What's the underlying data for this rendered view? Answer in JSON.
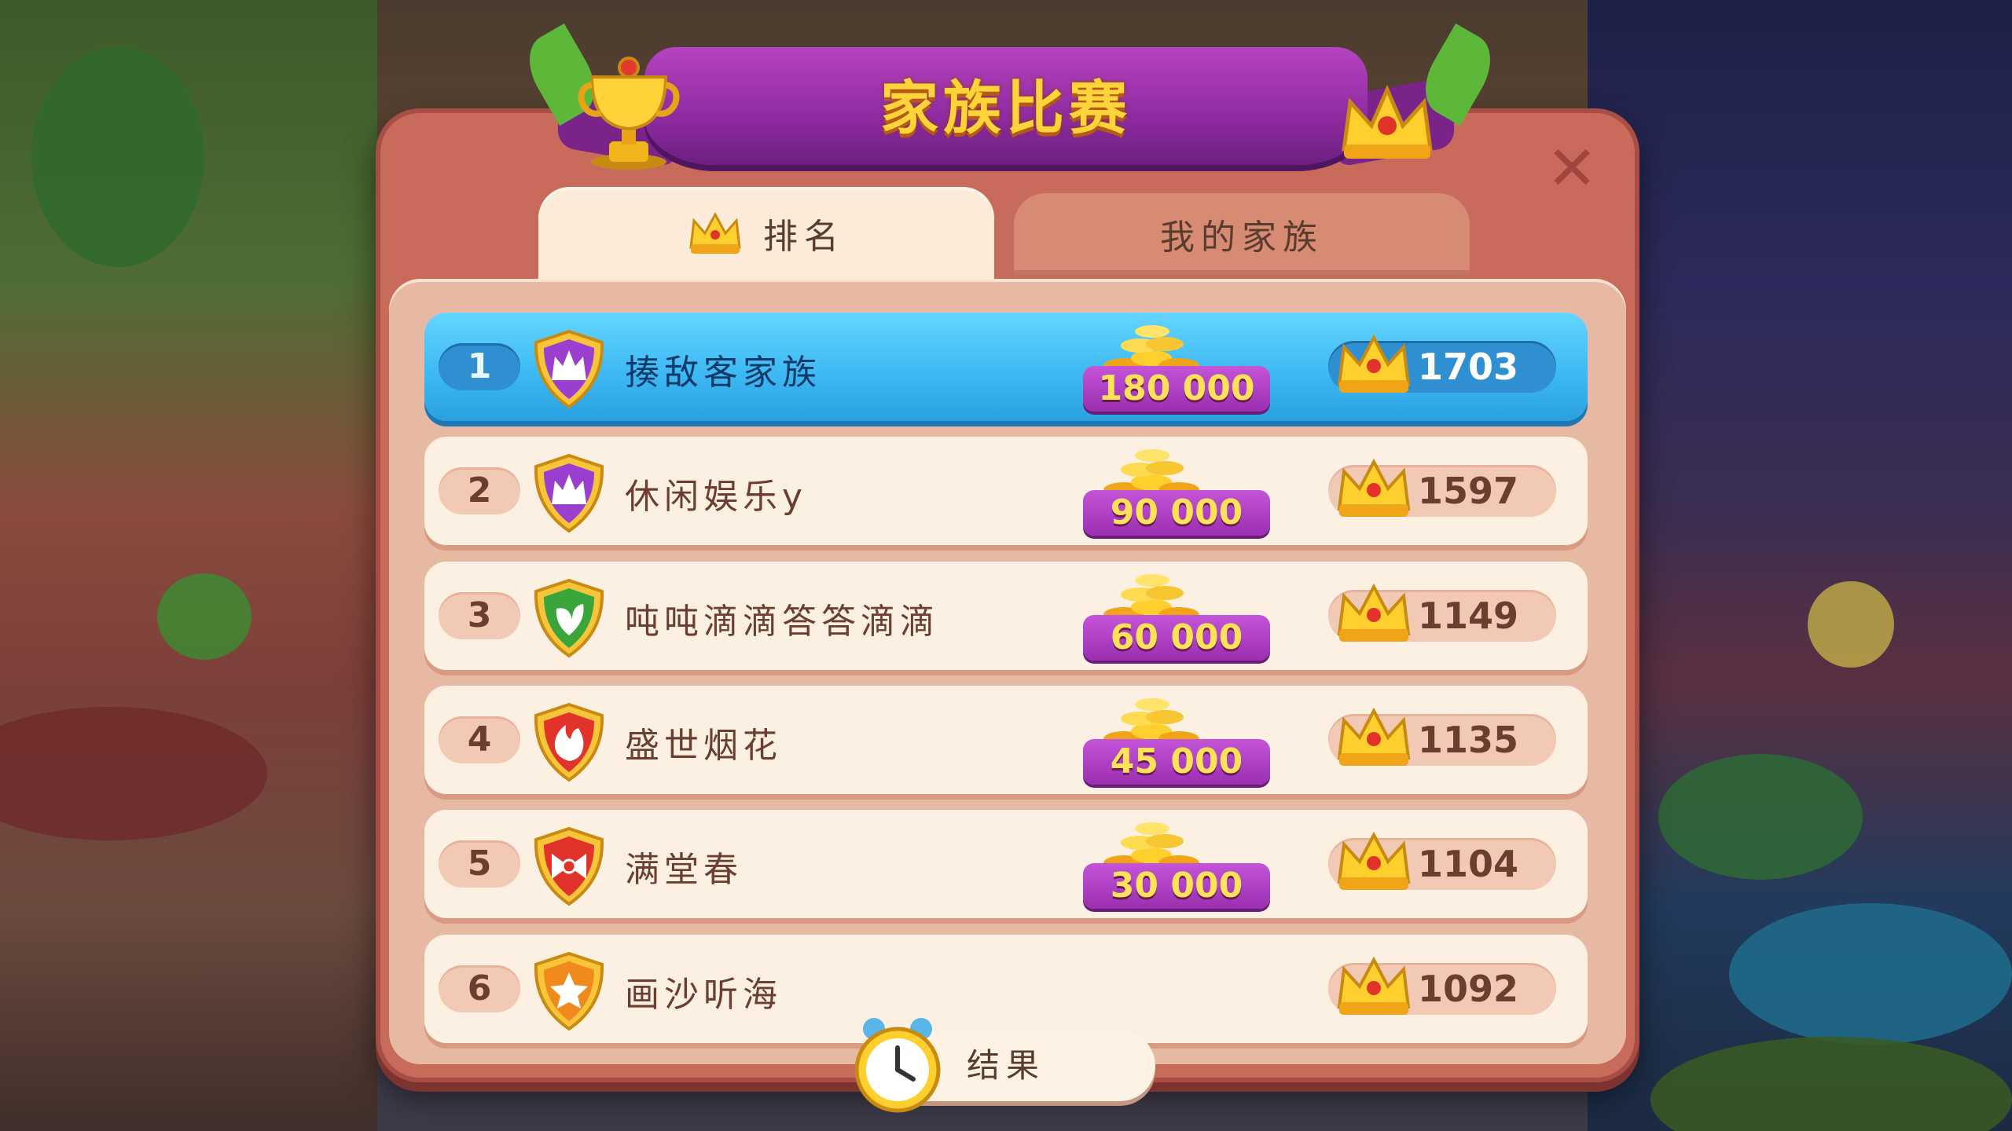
{
  "title": "家族比赛",
  "tabs": [
    {
      "label": "排名",
      "active": true
    },
    {
      "label": "我的家族",
      "active": false
    }
  ],
  "rows": [
    {
      "rank": "1",
      "name": "揍敌客家族",
      "prize": "180 000",
      "score": "1703",
      "badge": "crown-badge-icon",
      "badge_color": "#9b3fd0"
    },
    {
      "rank": "2",
      "name": "休闲娱乐y",
      "prize": "90 000",
      "score": "1597",
      "badge": "crown-badge-icon",
      "badge_color": "#9b3fd0"
    },
    {
      "rank": "3",
      "name": "吨吨滴滴答答滴滴",
      "prize": "60 000",
      "score": "1149",
      "badge": "leaf-badge-icon",
      "badge_color": "#3aa53a"
    },
    {
      "rank": "4",
      "name": "盛世烟花",
      "prize": "45 000",
      "score": "1135",
      "badge": "flame-badge-icon",
      "badge_color": "#e2332b"
    },
    {
      "rank": "5",
      "name": "满堂春",
      "prize": "30 000",
      "score": "1104",
      "badge": "bow-badge-icon",
      "badge_color": "#e2332b"
    },
    {
      "rank": "6",
      "name": "画沙听海",
      "prize": "",
      "score": "1092",
      "badge": "star-badge-icon",
      "badge_color": "#f08a1c"
    }
  ],
  "result_label": "结果",
  "close_icon": "close-icon",
  "colors": {
    "highlight": "#3bb7f2",
    "prize_ribbon": "#9a2fb0",
    "gold": "#ffd43b"
  }
}
